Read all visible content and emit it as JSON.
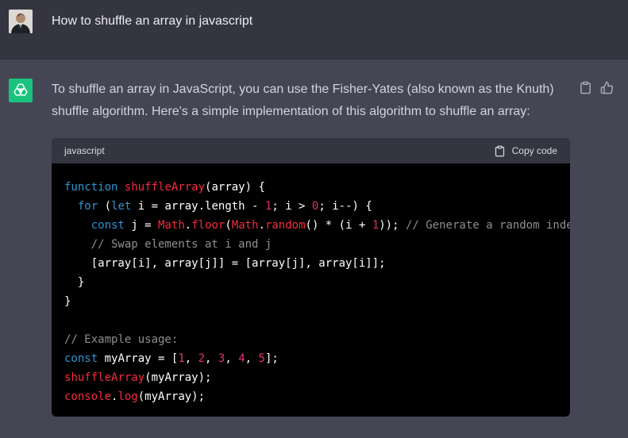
{
  "user_message": {
    "text": "How to shuffle an array in javascript"
  },
  "assistant_message": {
    "text": "To shuffle an array in JavaScript, you can use the Fisher-Yates (also known as the Knuth) shuffle algorithm. Here's a simple implementation of this algorithm to shuffle an array:",
    "actions": [
      "clipboard-icon",
      "thumbs-up-icon"
    ]
  },
  "code_block": {
    "language": "javascript",
    "copy_label": "Copy code",
    "lines": [
      [
        {
          "t": "function",
          "c": "kw"
        },
        {
          "t": " ",
          "c": "pl"
        },
        {
          "t": "shuffleArray",
          "c": "fn"
        },
        {
          "t": "(array) {",
          "c": "pl"
        }
      ],
      [
        {
          "t": "  ",
          "c": "pl"
        },
        {
          "t": "for",
          "c": "kw"
        },
        {
          "t": " (",
          "c": "pl"
        },
        {
          "t": "let",
          "c": "kw"
        },
        {
          "t": " i = array.",
          "c": "pl"
        },
        {
          "t": "length",
          "c": "pl"
        },
        {
          "t": " - ",
          "c": "pl"
        },
        {
          "t": "1",
          "c": "num"
        },
        {
          "t": "; i > ",
          "c": "pl"
        },
        {
          "t": "0",
          "c": "num"
        },
        {
          "t": "; i--) {",
          "c": "pl"
        }
      ],
      [
        {
          "t": "    ",
          "c": "pl"
        },
        {
          "t": "const",
          "c": "kw"
        },
        {
          "t": " j = ",
          "c": "pl"
        },
        {
          "t": "Math",
          "c": "fn"
        },
        {
          "t": ".",
          "c": "pl"
        },
        {
          "t": "floor",
          "c": "fn"
        },
        {
          "t": "(",
          "c": "pl"
        },
        {
          "t": "Math",
          "c": "fn"
        },
        {
          "t": ".",
          "c": "pl"
        },
        {
          "t": "random",
          "c": "fn"
        },
        {
          "t": "() * (i + ",
          "c": "pl"
        },
        {
          "t": "1",
          "c": "num"
        },
        {
          "t": ")); ",
          "c": "pl"
        },
        {
          "t": "// Generate a random inde",
          "c": "cm"
        }
      ],
      [
        {
          "t": "    ",
          "c": "pl"
        },
        {
          "t": "// Swap elements at i and j",
          "c": "cm"
        }
      ],
      [
        {
          "t": "    [array[i], array[j]] = [array[j], array[i]];",
          "c": "pl"
        }
      ],
      [
        {
          "t": "  }",
          "c": "pl"
        }
      ],
      [
        {
          "t": "}",
          "c": "pl"
        }
      ],
      [
        {
          "t": "",
          "c": "pl"
        }
      ],
      [
        {
          "t": "// Example usage:",
          "c": "cm"
        }
      ],
      [
        {
          "t": "const",
          "c": "kw"
        },
        {
          "t": " myArray = [",
          "c": "pl"
        },
        {
          "t": "1",
          "c": "num"
        },
        {
          "t": ", ",
          "c": "pl"
        },
        {
          "t": "2",
          "c": "num"
        },
        {
          "t": ", ",
          "c": "pl"
        },
        {
          "t": "3",
          "c": "num"
        },
        {
          "t": ", ",
          "c": "pl"
        },
        {
          "t": "4",
          "c": "num"
        },
        {
          "t": ", ",
          "c": "pl"
        },
        {
          "t": "5",
          "c": "num"
        },
        {
          "t": "];",
          "c": "pl"
        }
      ],
      [
        {
          "t": "shuffleArray",
          "c": "fn"
        },
        {
          "t": "(myArray);",
          "c": "pl"
        }
      ],
      [
        {
          "t": "console",
          "c": "fn"
        },
        {
          "t": ".",
          "c": "pl"
        },
        {
          "t": "log",
          "c": "fn"
        },
        {
          "t": "(myArray);",
          "c": "pl"
        }
      ]
    ]
  },
  "colors": {
    "kw": "#2e95d3",
    "fn": "#f22c3d",
    "num": "#df3079",
    "cm": "#8f8f8f",
    "pl": "#ffffff",
    "accent": "#19c37d"
  }
}
